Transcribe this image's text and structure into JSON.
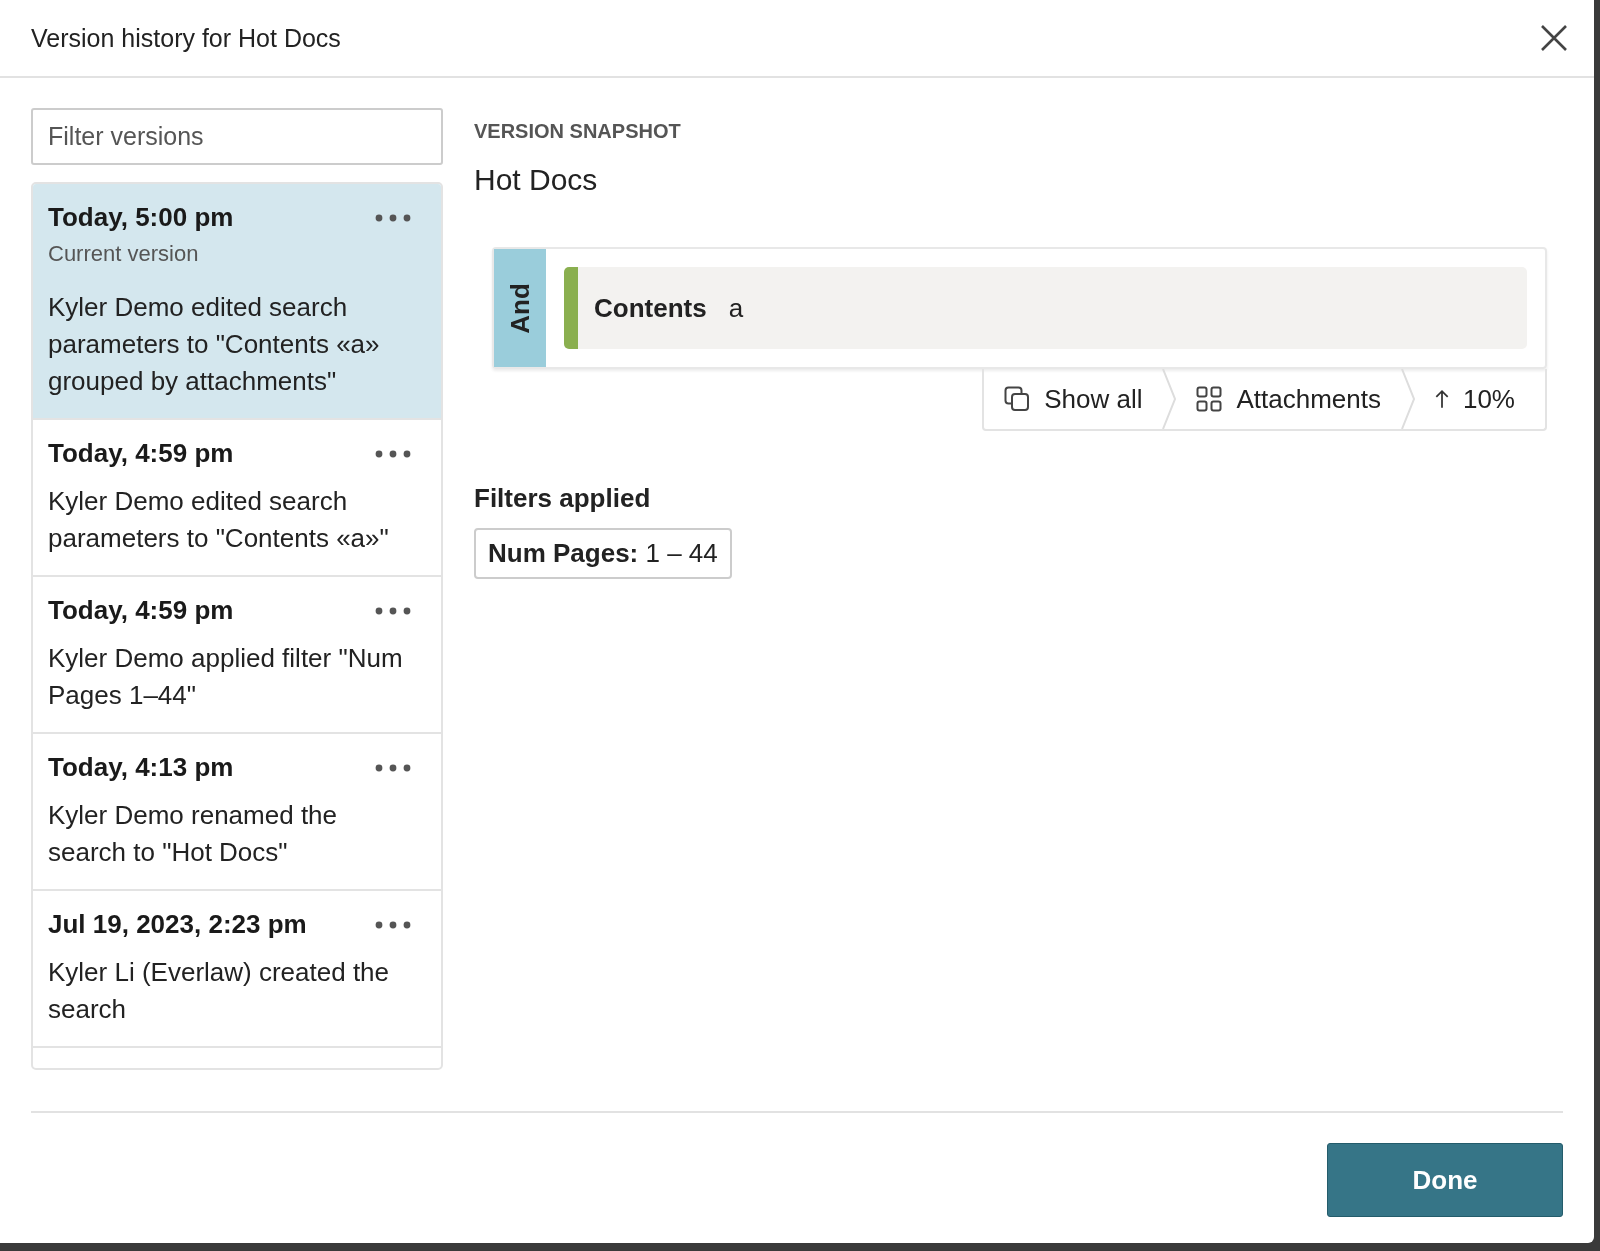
{
  "dialog": {
    "title": "Version history for Hot Docs"
  },
  "filter": {
    "placeholder": "Filter versions"
  },
  "versions": [
    {
      "date": "Today, 5:00 pm",
      "subtitle": "Current version",
      "description": "Kyler Demo edited search parameters to \"Contents «a» grouped by attachments\"",
      "selected": true
    },
    {
      "date": "Today, 4:59 pm",
      "description": "Kyler Demo edited search parameters to \"Contents «a»\"",
      "selected": false
    },
    {
      "date": "Today, 4:59 pm",
      "description": "Kyler Demo applied filter \"Num Pages 1–44\"",
      "selected": false
    },
    {
      "date": "Today, 4:13 pm",
      "description": "Kyler Demo renamed the search to \"Hot Docs\"",
      "selected": false
    },
    {
      "date": "Jul 19, 2023, 2:23 pm",
      "description": "Kyler Li (Everlaw) created the search",
      "selected": false
    }
  ],
  "snapshot": {
    "label": "VERSION SNAPSHOT",
    "title": "Hot Docs",
    "query": {
      "operator": "And",
      "field": "Contents",
      "value": "a"
    },
    "options": [
      {
        "kind": "copies",
        "label": "Show all"
      },
      {
        "kind": "grid",
        "label": "Attachments"
      },
      {
        "kind": "arrow",
        "label": "10%"
      }
    ],
    "filters_heading": "Filters applied",
    "filters": [
      {
        "name": "Num Pages:",
        "value": "1 – 44"
      }
    ]
  },
  "buttons": {
    "done": "Done"
  }
}
